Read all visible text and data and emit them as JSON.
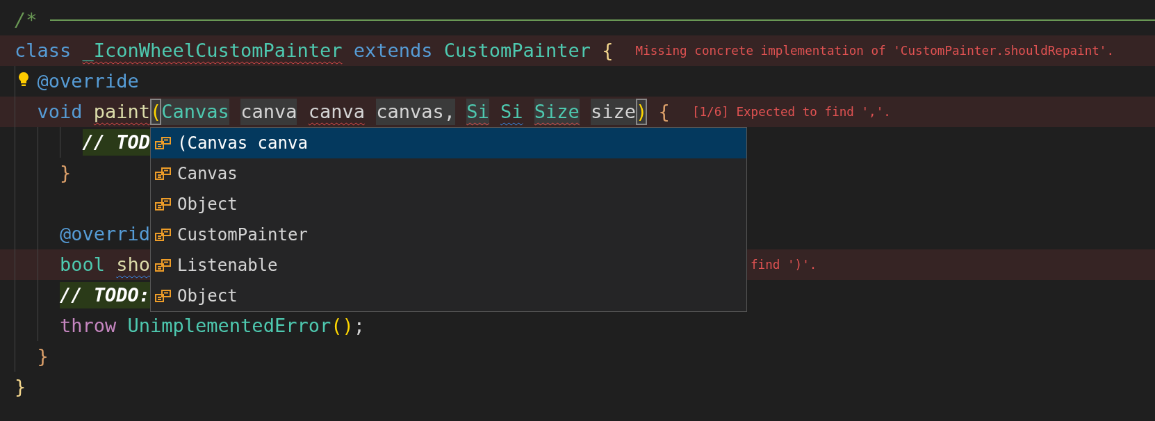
{
  "editor": {
    "lines": [
      {
        "rule": true,
        "tokens": [
          {
            "text": "/*",
            "kind": "comment"
          }
        ]
      },
      {
        "error_line": true,
        "tokens": [
          {
            "text": "class",
            "kind": "keyword"
          },
          {
            "text": "_IconWheelCustomPainter",
            "kind": "type",
            "space": true,
            "error": true
          },
          {
            "text": "extends",
            "kind": "keyword",
            "space": true
          },
          {
            "text": "CustomPainter",
            "kind": "type",
            "space": true
          },
          {
            "text": "{",
            "kind": "brace1",
            "space": true
          }
        ],
        "message": "Missing concrete implementation of 'CustomPainter.shouldRepaint'."
      },
      {
        "lightbulb": true,
        "tokens": [
          {
            "text": "  @override",
            "kind": "keyword"
          }
        ]
      },
      {
        "error_line": true,
        "tokens": [
          {
            "text": "  void",
            "kind": "keyword"
          },
          {
            "text": "paint",
            "kind": "function",
            "space": true,
            "error": true
          },
          {
            "text": "(",
            "kind": "paren",
            "boxed": true
          },
          {
            "text": "Canvas",
            "kind": "type",
            "highlight": true
          },
          {
            "text": "canva",
            "kind": "plain",
            "space": true,
            "highlight": true
          },
          {
            "text": "canva",
            "kind": "plain",
            "space": true,
            "error": true
          },
          {
            "text": "canvas,",
            "kind": "plain",
            "space": true,
            "highlight": true
          },
          {
            "text": "Si",
            "kind": "type",
            "space": true,
            "highlight": true,
            "error": true
          },
          {
            "text": "Si",
            "kind": "type",
            "space": true,
            "hint": true
          },
          {
            "text": "Size",
            "kind": "type",
            "space": true,
            "highlight": true,
            "error": true
          },
          {
            "text": "size",
            "kind": "plain",
            "space": true,
            "highlight": true
          },
          {
            "text": ")",
            "kind": "paren",
            "boxed": true
          },
          {
            "text": "{",
            "kind": "brace2",
            "space": true
          }
        ],
        "message": "[1/6] Expected to find ','."
      },
      {
        "tokens": [
          {
            "text": "      // TOD",
            "kind": "todo"
          }
        ]
      },
      {
        "tokens": [
          {
            "text": "    }",
            "kind": "brace2"
          }
        ]
      },
      {
        "blank_before": true,
        "tokens": [
          {
            "text": "    @overrid",
            "kind": "keyword"
          }
        ]
      },
      {
        "error_line": true,
        "tokens": [
          {
            "text": "    bool",
            "kind": "type"
          },
          {
            "text": "sho",
            "kind": "function",
            "space": true,
            "hint": true
          }
        ],
        "message": "find ')'."
      },
      {
        "tokens": [
          {
            "text": "    // TODO:",
            "kind": "todo"
          }
        ]
      },
      {
        "tokens": [
          {
            "text": "    throw",
            "kind": "control"
          },
          {
            "text": "UnimplementedError",
            "kind": "type",
            "space": true
          },
          {
            "text": "()",
            "kind": "paren"
          },
          {
            "text": ";",
            "kind": "plain"
          }
        ]
      },
      {
        "tokens": [
          {
            "text": "  }",
            "kind": "brace2"
          }
        ]
      },
      {
        "tokens": [
          {
            "text": "}",
            "kind": "brace1"
          }
        ]
      }
    ]
  },
  "suggestions": {
    "items": [
      {
        "label": "(Canvas canva",
        "selected": true
      },
      {
        "label": "Canvas",
        "selected": false
      },
      {
        "label": "Object",
        "selected": false
      },
      {
        "label": "CustomPainter",
        "selected": false
      },
      {
        "label": "Listenable",
        "selected": false
      },
      {
        "label": "Object",
        "selected": false
      }
    ]
  }
}
